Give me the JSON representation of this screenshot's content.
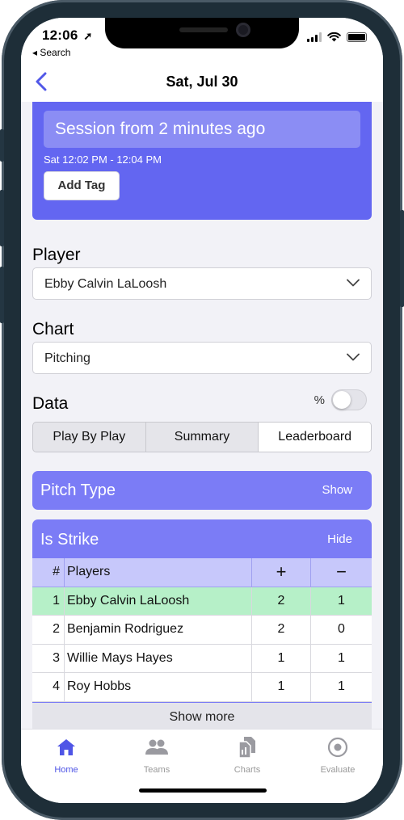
{
  "status_bar": {
    "time": "12:06",
    "back_label": "◂ Search"
  },
  "nav": {
    "title": "Sat, Jul 30"
  },
  "session": {
    "title": "Session from 2 minutes ago",
    "time_range": "Sat 12:02 PM - 12:04 PM",
    "add_tag_label": "Add Tag"
  },
  "player": {
    "label": "Player",
    "selected": "Ebby Calvin LaLoosh"
  },
  "chart": {
    "label": "Chart",
    "selected": "Pitching"
  },
  "data": {
    "label": "Data",
    "percent_label": "%",
    "percent_enabled": false,
    "tabs": [
      {
        "label": "Play By Play"
      },
      {
        "label": "Summary"
      },
      {
        "label": "Leaderboard"
      }
    ],
    "active_tab": "Leaderboard"
  },
  "pitch_type": {
    "title": "Pitch Type",
    "action": "Show"
  },
  "is_strike": {
    "title": "Is Strike",
    "action": "Hide",
    "headers": {
      "num": "#",
      "players": "Players",
      "plus": "+",
      "minus": "−"
    },
    "rows": [
      {
        "num": "1",
        "name": "Ebby Calvin LaLoosh",
        "plus": "2",
        "minus": "1"
      },
      {
        "num": "2",
        "name": "Benjamin Rodriguez",
        "plus": "2",
        "minus": "0"
      },
      {
        "num": "3",
        "name": "Willie Mays Hayes",
        "plus": "1",
        "minus": "1"
      },
      {
        "num": "4",
        "name": "Roy Hobbs",
        "plus": "1",
        "minus": "1"
      }
    ],
    "show_more_label": "Show more"
  },
  "tabbar": {
    "items": [
      {
        "label": "Home",
        "icon": "home-icon"
      },
      {
        "label": "Teams",
        "icon": "people-icon"
      },
      {
        "label": "Charts",
        "icon": "documents-icon"
      },
      {
        "label": "Evaluate",
        "icon": "target-icon"
      }
    ],
    "active": "Home"
  },
  "colors": {
    "accent": "#6366f1",
    "card": "#7b7cf6",
    "highlight_row": "#b6f0c8",
    "tab_active": "#4f55e6"
  }
}
